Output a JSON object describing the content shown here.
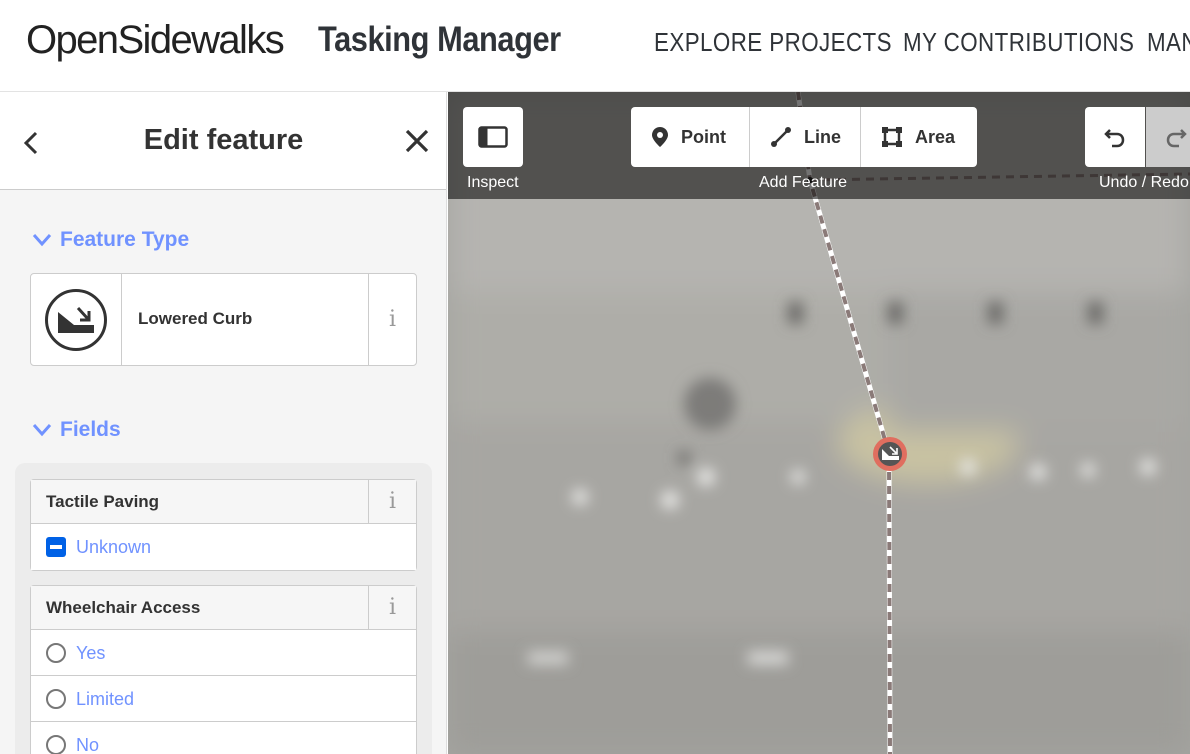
{
  "header": {
    "logo_text": "OpenSidewalks",
    "app_title": "Tasking Manager",
    "nav": [
      "EXPLORE PROJECTS",
      "MY CONTRIBUTIONS",
      "MAN"
    ]
  },
  "sidebar": {
    "title": "Edit feature",
    "feature_type_heading": "Feature Type",
    "preset_name": "Lowered Curb",
    "info_glyph": "i",
    "fields_heading": "Fields",
    "fields": [
      {
        "label": "Tactile Paving",
        "type": "checkbox",
        "options": [
          {
            "label": "Unknown",
            "state": "indeterminate"
          }
        ]
      },
      {
        "label": "Wheelchair Access",
        "type": "radio",
        "options": [
          {
            "label": "Yes"
          },
          {
            "label": "Limited"
          },
          {
            "label": "No"
          }
        ]
      }
    ]
  },
  "map": {
    "toolbar": {
      "inspect_label": "Inspect",
      "add_feature_label": "Add Feature",
      "undo_redo_label": "Undo / Redo",
      "modes": [
        "Point",
        "Line",
        "Area"
      ]
    }
  },
  "colors": {
    "accent": "#7092ff",
    "checkbox": "#0061e6",
    "vertex_ring": "#e06e5f",
    "toolbar_bg": "#5a5a58"
  },
  "icons": [
    "back-icon",
    "close-icon",
    "chevron-down-icon",
    "lowered-curb-icon",
    "info-icon",
    "sidebar-toggle-icon",
    "point-pin-icon",
    "line-icon",
    "area-icon",
    "undo-icon",
    "redo-icon"
  ]
}
